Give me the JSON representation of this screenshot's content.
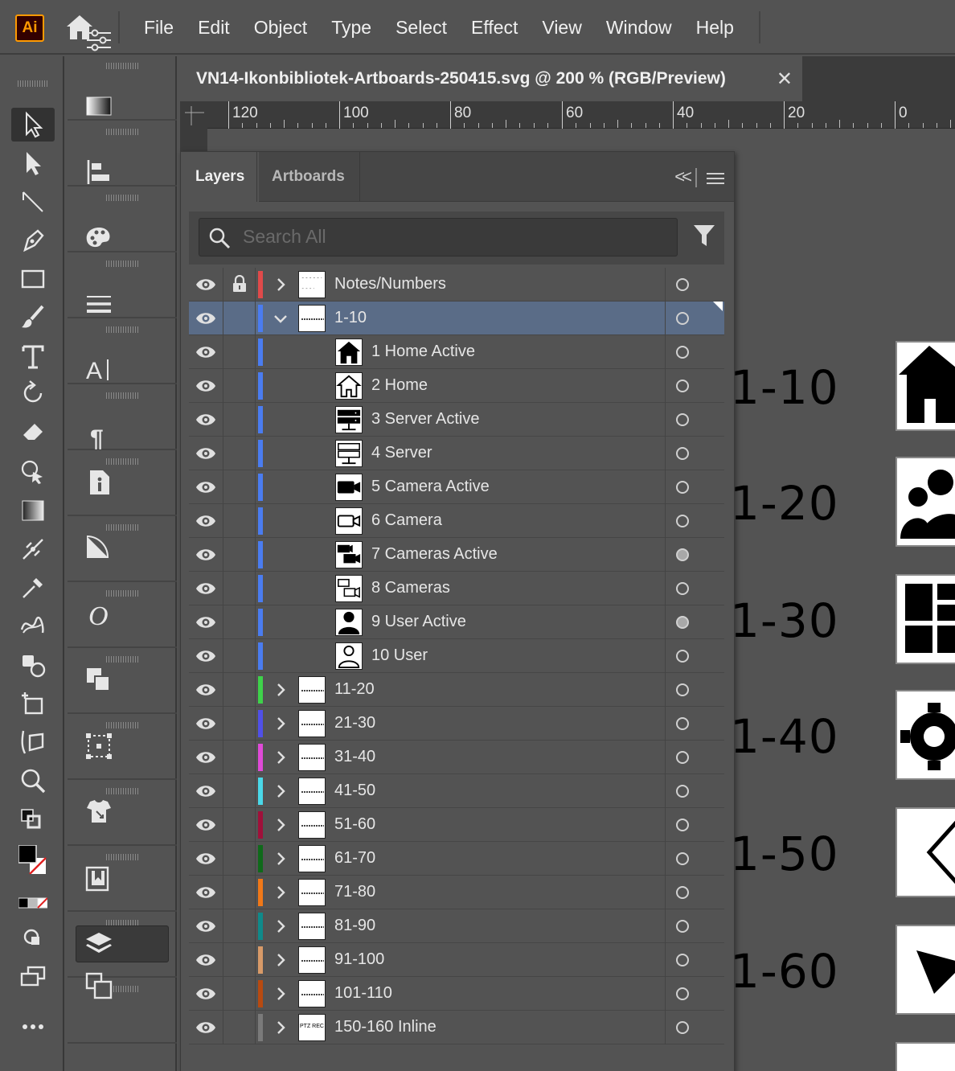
{
  "app": {
    "logo": "Ai",
    "menus": [
      "File",
      "Edit",
      "Object",
      "Type",
      "Select",
      "Effect",
      "View",
      "Window",
      "Help"
    ],
    "accent": "#ff9a00",
    "selection_color": "#5a6c87"
  },
  "collapse_glyphs": {
    "tools": "»",
    "panels": "»"
  },
  "document": {
    "tab_title": "VN14-Ikonbibliotek-Artboards-250415.svg @ 200 % (RGB/Preview)",
    "close_glyph": "✕"
  },
  "ruler": {
    "labels": [
      "120",
      "100",
      "80",
      "60",
      "40",
      "20",
      "0"
    ]
  },
  "tools": [
    {
      "icon": "selection-tool-icon"
    },
    {
      "icon": "direct-selection-tool-icon"
    },
    {
      "icon": "line-segment-tool-icon"
    },
    {
      "icon": "pen-tool-icon"
    },
    {
      "icon": "rectangle-tool-icon"
    },
    {
      "icon": "paintbrush-tool-icon"
    },
    {
      "icon": "type-tool-icon"
    },
    {
      "icon": "rotate-tool-icon"
    },
    {
      "icon": "eraser-tool-icon"
    },
    {
      "icon": "shape-builder-tool-icon"
    },
    {
      "icon": "gradient-tool-icon"
    },
    {
      "icon": "width-tool-icon"
    },
    {
      "icon": "eyedropper-tool-icon"
    },
    {
      "icon": "blend-tool-icon"
    },
    {
      "icon": "symbol-sprayer-tool-icon"
    },
    {
      "icon": "artboard-tool-icon"
    },
    {
      "icon": "free-transform-tool-icon"
    },
    {
      "icon": "zoom-tool-icon"
    },
    {
      "icon": "default-fill-stroke-icon"
    },
    {
      "icon": "fill-stroke-icon"
    },
    {
      "icon": "color-modes-icon"
    },
    {
      "icon": "draw-mode-icon"
    },
    {
      "icon": "screen-mode-icon"
    },
    {
      "icon": "more-tools-icon"
    }
  ],
  "panel_icons": [
    "properties-icon",
    "gradient-panel-icon",
    "align-panel-icon",
    "color-panel-icon",
    "stroke-panel-icon",
    "character-panel-icon",
    "paragraph-panel-icon",
    "document-info-icon",
    "transparency-panel-icon",
    "glyphs-panel-icon",
    "pathfinder-panel-icon",
    "transform-panel-icon",
    "asset-export-icon",
    "libraries-icon",
    "layers-panel-icon",
    "artboards-panel-icon"
  ],
  "text_panel_glyphs": {
    "character": "A",
    "paragraph": "¶",
    "glyphs": "O"
  },
  "layers_panel": {
    "tabs": [
      "Layers",
      "Artboards"
    ],
    "collapse_glyph": "<<",
    "search_placeholder": "Search All",
    "rows": [
      {
        "name": "Notes/Numbers",
        "color": "#e04a4a",
        "level": 0,
        "expanded": false,
        "locked": true,
        "selected": false,
        "target_filled": false,
        "thumb": "notes"
      },
      {
        "name": "1-10",
        "color": "#4a7cf0",
        "level": 0,
        "expanded": true,
        "locked": false,
        "selected": true,
        "target_filled": false,
        "thumb": "dash"
      },
      {
        "name": "1 Home Active",
        "color": "#4a7cf0",
        "level": 1,
        "locked": false,
        "selected": false,
        "target_filled": false,
        "thumb": "home-filled"
      },
      {
        "name": "2 Home",
        "color": "#4a7cf0",
        "level": 1,
        "locked": false,
        "selected": false,
        "target_filled": false,
        "thumb": "home-outline"
      },
      {
        "name": "3 Server Active",
        "color": "#4a7cf0",
        "level": 1,
        "locked": false,
        "selected": false,
        "target_filled": false,
        "thumb": "server-filled"
      },
      {
        "name": "4 Server",
        "color": "#4a7cf0",
        "level": 1,
        "locked": false,
        "selected": false,
        "target_filled": false,
        "thumb": "server-outline"
      },
      {
        "name": "5 Camera Active",
        "color": "#4a7cf0",
        "level": 1,
        "locked": false,
        "selected": false,
        "target_filled": false,
        "thumb": "camera-filled"
      },
      {
        "name": "6 Camera",
        "color": "#4a7cf0",
        "level": 1,
        "locked": false,
        "selected": false,
        "target_filled": false,
        "thumb": "camera-outline"
      },
      {
        "name": "7 Cameras Active",
        "color": "#4a7cf0",
        "level": 1,
        "locked": false,
        "selected": false,
        "target_filled": true,
        "thumb": "cameras-filled"
      },
      {
        "name": "8 Cameras",
        "color": "#4a7cf0",
        "level": 1,
        "locked": false,
        "selected": false,
        "target_filled": false,
        "thumb": "cameras-outline"
      },
      {
        "name": "9 User Active",
        "color": "#4a7cf0",
        "level": 1,
        "locked": false,
        "selected": false,
        "target_filled": true,
        "thumb": "user-filled"
      },
      {
        "name": "10 User",
        "color": "#4a7cf0",
        "level": 1,
        "locked": false,
        "selected": false,
        "target_filled": false,
        "thumb": "user-outline"
      },
      {
        "name": "11-20",
        "color": "#3ed24a",
        "level": 0,
        "expanded": false,
        "locked": false,
        "selected": false,
        "target_filled": false,
        "thumb": "dash"
      },
      {
        "name": "21-30",
        "color": "#5050e8",
        "level": 0,
        "expanded": false,
        "locked": false,
        "selected": false,
        "target_filled": false,
        "thumb": "dash"
      },
      {
        "name": "31-40",
        "color": "#e04ad8",
        "level": 0,
        "expanded": false,
        "locked": false,
        "selected": false,
        "target_filled": false,
        "thumb": "dash"
      },
      {
        "name": "41-50",
        "color": "#4ad8e8",
        "level": 0,
        "expanded": false,
        "locked": false,
        "selected": false,
        "target_filled": false,
        "thumb": "dash"
      },
      {
        "name": "51-60",
        "color": "#a0103a",
        "level": 0,
        "expanded": false,
        "locked": false,
        "selected": false,
        "target_filled": false,
        "thumb": "dash"
      },
      {
        "name": "61-70",
        "color": "#0f6a1a",
        "level": 0,
        "expanded": false,
        "locked": false,
        "selected": false,
        "target_filled": false,
        "thumb": "dash"
      },
      {
        "name": "71-80",
        "color": "#f07818",
        "level": 0,
        "expanded": false,
        "locked": false,
        "selected": false,
        "target_filled": false,
        "thumb": "dash"
      },
      {
        "name": "81-90",
        "color": "#0f8a8a",
        "level": 0,
        "expanded": false,
        "locked": false,
        "selected": false,
        "target_filled": false,
        "thumb": "dash"
      },
      {
        "name": "91-100",
        "color": "#d89a68",
        "level": 0,
        "expanded": false,
        "locked": false,
        "selected": false,
        "target_filled": false,
        "thumb": "dash"
      },
      {
        "name": "101-110",
        "color": "#b84a10",
        "level": 0,
        "expanded": false,
        "locked": false,
        "selected": false,
        "target_filled": false,
        "thumb": "dash"
      },
      {
        "name": "150-160 Inline",
        "color": "#7a7a7a",
        "level": 0,
        "expanded": false,
        "locked": false,
        "selected": false,
        "target_filled": false,
        "thumb": "ptz",
        "thumb_text": "PTZ REC"
      }
    ]
  },
  "canvas": {
    "range_labels": [
      "1-10",
      "1-20",
      "1-30",
      "1-40",
      "1-50",
      "1-60"
    ],
    "artboards": [
      "home-icon",
      "users-icon",
      "grid-icon",
      "gear-icon",
      "chevron-left-icon",
      "play-icon"
    ]
  }
}
